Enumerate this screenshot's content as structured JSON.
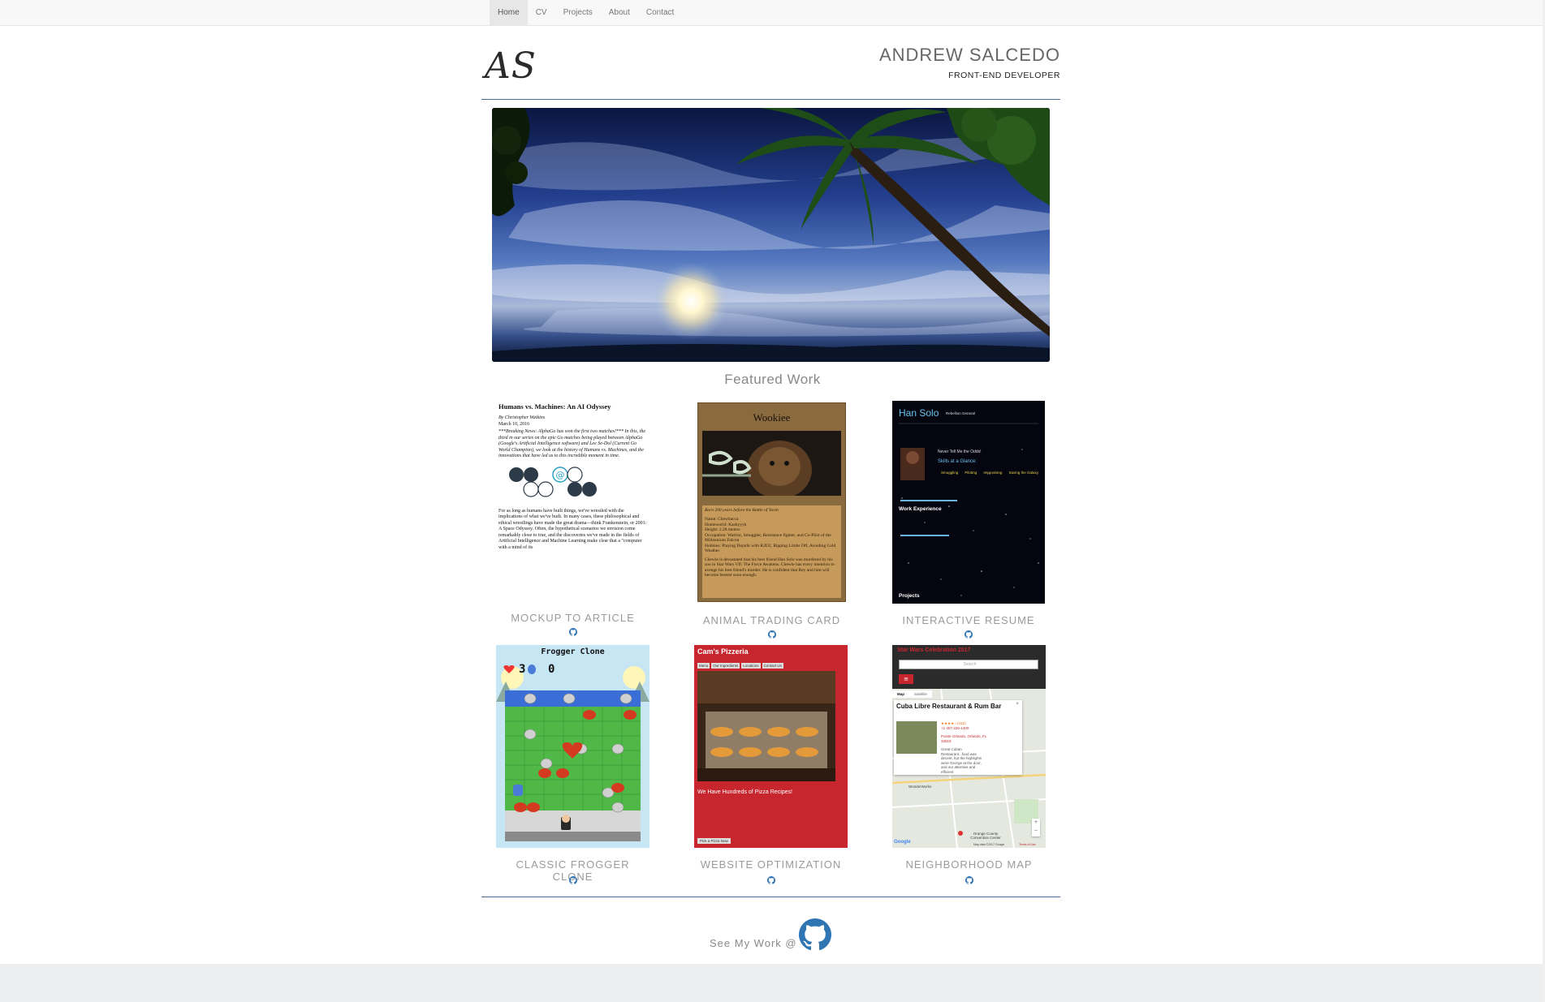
{
  "nav": {
    "items": [
      {
        "label": "Home",
        "active": true
      },
      {
        "label": "CV",
        "active": false
      },
      {
        "label": "Projects",
        "active": false
      },
      {
        "label": "About",
        "active": false
      },
      {
        "label": "Contact",
        "active": false
      }
    ]
  },
  "header": {
    "logo": "AS",
    "name": "ANDREW SALCEDO",
    "role": "FRONT-END DEVELOPER"
  },
  "featured": {
    "title": "Featured Work",
    "projects": [
      {
        "label": "MOCKUP TO ARTICLE",
        "icon": "github-icon"
      },
      {
        "label": "ANIMAL TRADING CARD",
        "icon": "github-icon"
      },
      {
        "label": "INTERACTIVE RESUME",
        "icon": "github-icon"
      },
      {
        "label": "CLASSIC FROGGER CLONE",
        "icon": "github-icon"
      },
      {
        "label": "WEBSITE OPTIMIZATION",
        "icon": "github-icon"
      },
      {
        "label": "NEIGHBORHOOD MAP",
        "icon": "github-icon"
      }
    ]
  },
  "article_thumb": {
    "title": "Humans vs. Machines: An AI Odyssey",
    "byline": "By Christopher Watkins",
    "date": "March 10, 2016",
    "lead": "***Breaking News: AlphaGo has won the first two matches!*** In this, the third in our series on the epic Go matches being played between AlphaGo (Google's Artificial Intelligence software) and Lee Se-Dol (Current Go World Champion), we look at the history of Humans vs. Machines, and the innovations that have led us to this incredible moment in time.",
    "body": "For as long as humans have built things, we've wrestled with the implications of what we've built. In many cases, these philosophical and ethical wrestlings have made the great drama—think Frankenstein, or 2001: A Space Odyssey. Often, the hypothetical scenarios we envision come remarkably close to true, and the discoveries we've made in the fields of Artificial Intelligence and Machine Learning make clear that a \"computer with a mind of its"
  },
  "wookiee_thumb": {
    "title": "Wookiee",
    "caption": "Born 200 years before the Battle of Yavin",
    "name": "Name: Chewbacca",
    "homeworld": "Homeworld: Kashyyyk",
    "height": "Height: 2.28 meters",
    "occupation": "Occupation: Warrior, Smuggler, Resistance fighter, and Co-Pilot of the Millennium Falcon",
    "hobbies": "Hobbies: Playing Dejarik with R2D2, Ripping Limbs Off, Avoiding Cold Weather",
    "story": "Chewie is devastated that his best friend Han Solo was murdered by his son in Star Wars VII: The Force Awakens. Chewie has every intention to avenge his best friend's murder. He is confident that Rey and him will become bestest soon enough."
  },
  "resume_thumb": {
    "name": "Han Solo",
    "role": "Rebellion General",
    "experience_heading": "Work Experience",
    "projects_heading": "Projects",
    "quote": "Never Tell Me the Odds!",
    "skills_heading": "Skills at a Glance:",
    "skills": [
      "Smuggling",
      "Piloting",
      "Improvising",
      "Saving the Galaxy"
    ]
  },
  "frogger_thumb": {
    "title": "Frogger Clone",
    "lives": "3",
    "score": "0"
  },
  "pizza_thumb": {
    "title": "Cam's Pizzeria",
    "tabs": [
      "Menu",
      "Our Ingredients",
      "Locations",
      "Contact Us"
    ],
    "headline": "We Have Hundreds of Pizza Recipes!",
    "button": "Pick a Pizza Now"
  },
  "map_thumb": {
    "header": "Star Wars Celebration 2017",
    "search_placeholder": "Search",
    "tabs": [
      "Map",
      "Satellite"
    ],
    "place": "Cuba Libre Restaurant & Rum Bar",
    "rating": "(412)",
    "phone": "+1 407-226-1400",
    "address": "Pointe Orlando, Orlando, FL 32819",
    "review": "Great Cuban Restaurant...food was decent, but the highlights were George at the door, and our attentive and efficient",
    "label_1": "WonderWorks",
    "label_2": "Orange County Convention Center",
    "label_3": "Map data ©2017 Google",
    "label_4": "Terms of Use",
    "google": "Google"
  },
  "footer": {
    "see_work": "See My Work @",
    "icon": "github-icon"
  },
  "colors": {
    "rule": "#4a6a99",
    "nav_bg": "#f8f8f8",
    "footer_bg": "#eceef0",
    "label": "#9a9a9a",
    "github_blue": "#2f74b3"
  }
}
